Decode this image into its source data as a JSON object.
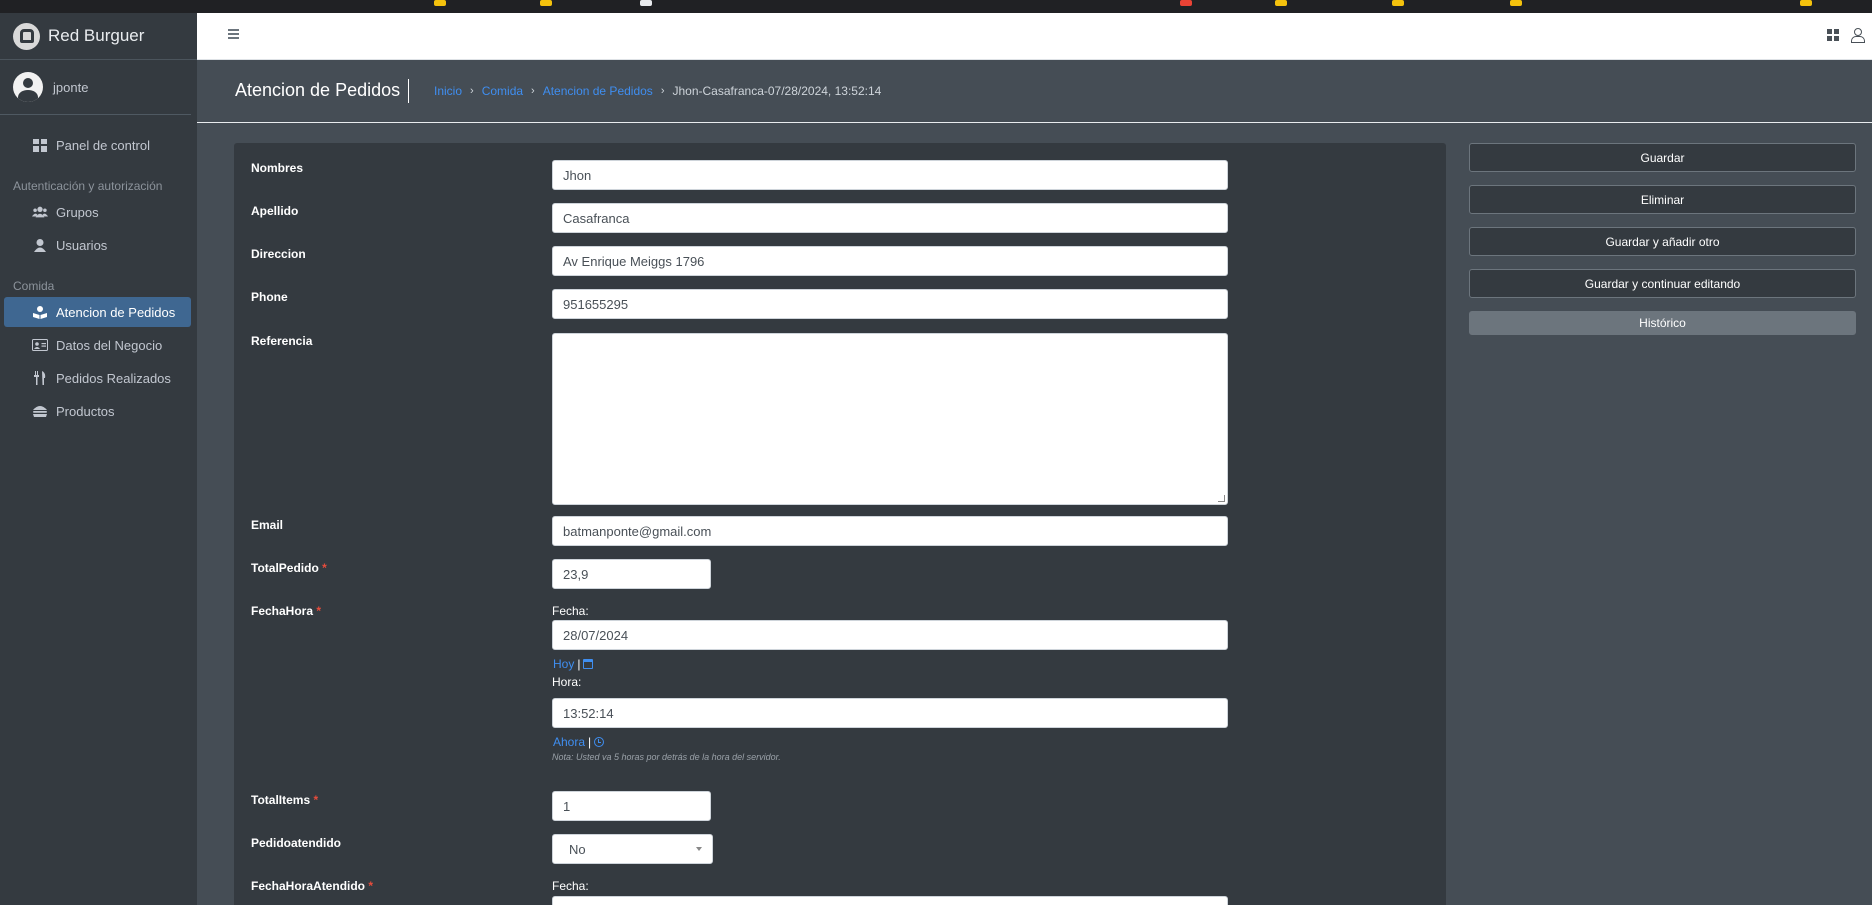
{
  "brand": {
    "name": "Red Burguer"
  },
  "user": {
    "name": "jponte"
  },
  "sidebar": {
    "items": [
      {
        "label": "Panel de control",
        "icon": "dashboard-icon"
      },
      {
        "section": "Autenticación y autorización"
      },
      {
        "label": "Grupos",
        "icon": "users-icon"
      },
      {
        "label": "Usuarios",
        "icon": "user-icon"
      },
      {
        "section": "Comida"
      },
      {
        "label": "Atencion de Pedidos",
        "icon": "book-reader-icon",
        "active": true
      },
      {
        "label": "Datos del Negocio",
        "icon": "id-card-icon"
      },
      {
        "label": "Pedidos Realizados",
        "icon": "utensils-icon"
      },
      {
        "label": "Productos",
        "icon": "hamburger-icon"
      }
    ]
  },
  "header": {
    "title": "Atencion de Pedidos",
    "breadcrumb": [
      "Inicio",
      "Comida",
      "Atencion de Pedidos",
      "Jhon-Casafranca-07/28/2024, 13:52:14"
    ]
  },
  "form": {
    "nombres": {
      "label": "Nombres",
      "value": "Jhon"
    },
    "apellido": {
      "label": "Apellido",
      "value": "Casafranca"
    },
    "direccion": {
      "label": "Direccion",
      "value": "Av Enrique Meiggs 1796"
    },
    "phone": {
      "label": "Phone",
      "value": "951655295"
    },
    "referencia": {
      "label": "Referencia",
      "value": ""
    },
    "email": {
      "label": "Email",
      "value": "batmanponte@gmail.com"
    },
    "total_pedido": {
      "label": "TotalPedido",
      "value": "23,9"
    },
    "fecha_hora": {
      "label": "FechaHora",
      "fecha_label": "Fecha:",
      "fecha_value": "28/07/2024",
      "hoy_link": "Hoy",
      "hora_label": "Hora:",
      "hora_value": "13:52:14",
      "ahora_link": "Ahora",
      "note": "Nota: Usted va 5 horas por detrás de la hora del servidor."
    },
    "total_items": {
      "label": "TotalItems",
      "value": "1"
    },
    "pedido_atendido": {
      "label": "Pedidoatendido",
      "value": "No"
    },
    "fecha_hora_atendido": {
      "label": "FechaHoraAtendido",
      "fecha_label": "Fecha:"
    },
    "required_mark": "*",
    "pipe": "|"
  },
  "actions": {
    "save": "Guardar",
    "delete": "Eliminar",
    "save_add": "Guardar y añadir otro",
    "save_continue": "Guardar y continuar editando",
    "history": "Histórico"
  },
  "colors": {
    "link": "#3f8ef0",
    "active_nav": "#3f6791",
    "sidebar_bg": "#343a40",
    "page_bg": "#454d55"
  }
}
